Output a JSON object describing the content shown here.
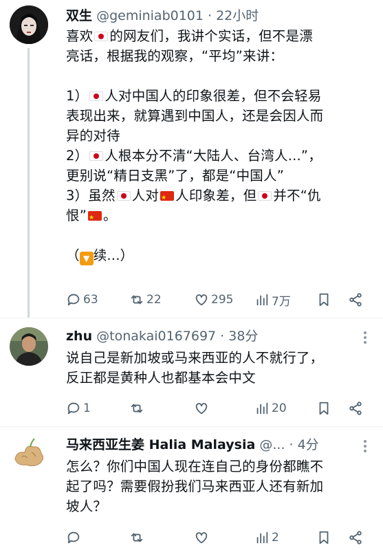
{
  "tweets": [
    {
      "name": "双生",
      "handle": "@geminiab0101 · 22小时",
      "seg": [
        "喜欢",
        "的网友们，我讲个实话，但不是漂\n亮话，根据我的观察，“平均”来讲：\n\n1）",
        "人对中国人的印象很差，但不会轻易\n表现出来，就算遇到中国人，还是会因人而\n异的对待\n2）",
        "人根本分不清“大陆人、台湾人...”，\n更别说“精日支黑”了，都是“中国人”\n3）虽然",
        "人对",
        "人印象差，但",
        "并不“仇\n恨”",
        "。\n\n（",
        "续...）"
      ],
      "icons": {
        "down": "▼"
      },
      "stats": {
        "reply": "63",
        "retweet": "22",
        "like": "295",
        "views": "7万"
      }
    },
    {
      "name": "zhu",
      "handle": "@tonakai0167697 · 38分",
      "text": "说自己是新加坡或马来西亚的人不就行了，\n反正都是黄种人也都基本会中文",
      "stats": {
        "reply": "1",
        "retweet": "",
        "like": "",
        "views": "20"
      }
    },
    {
      "name": "马来西亚生姜 Halia Malaysia",
      "handle": "@... · 4分",
      "text": "怎么？你们中国人现在连自己的身份都瞧不\n起了吗？需要假扮我们马来西亚人还有新加\n坡人？",
      "stats": {
        "reply": "",
        "retweet": "",
        "like": "",
        "views": "2"
      }
    }
  ]
}
